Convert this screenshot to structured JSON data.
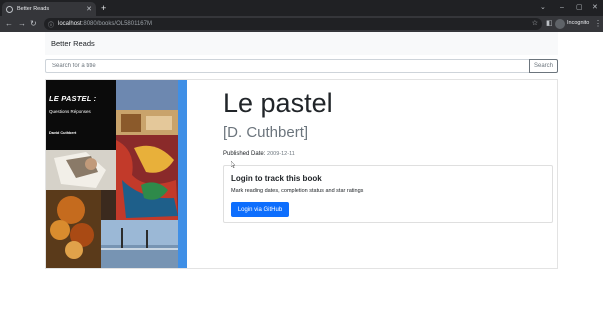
{
  "browser": {
    "tab_title": "Better Reads",
    "url_host": "localhost",
    "url_path": ":8080/books/OL5801167M",
    "profile_label": "Incognito"
  },
  "app": {
    "brand": "Better Reads",
    "search_placeholder": "Search for a title",
    "search_button": "Search"
  },
  "book": {
    "title": "Le pastel",
    "author": "[D. Cuthbert]",
    "published_label": "Published Date:",
    "published_date": "2009-12-11",
    "cover": {
      "title": "LE PASTEL :",
      "subtitle": "Questions Réponses",
      "author": "David Cuthbert"
    }
  },
  "login_card": {
    "title": "Login to track this book",
    "text": "Mark reading dates, completion status and star ratings",
    "button": "Login via GitHub"
  },
  "colors": {
    "primary": "#0d6efd",
    "chrome_dark": "#202124",
    "chrome_toolbar": "#35363a"
  }
}
